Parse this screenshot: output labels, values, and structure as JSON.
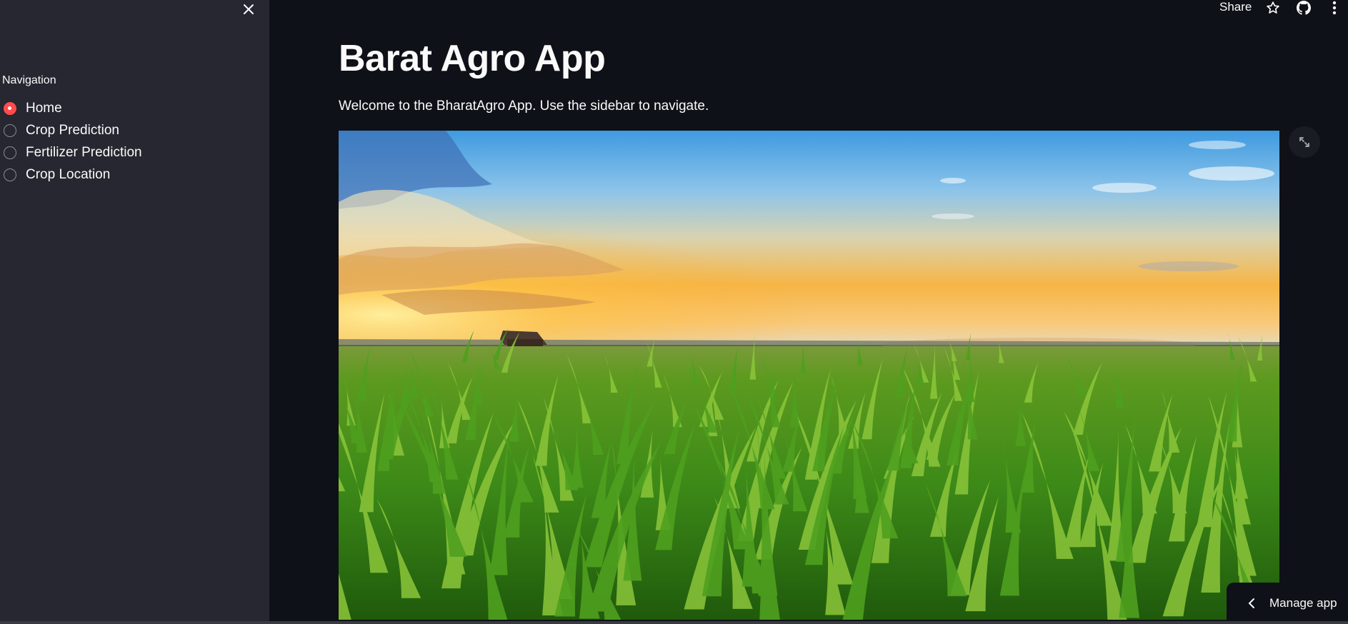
{
  "sidebar": {
    "nav_label": "Navigation",
    "items": [
      {
        "label": "Home",
        "selected": true
      },
      {
        "label": "Crop Prediction",
        "selected": false
      },
      {
        "label": "Fertilizer Prediction",
        "selected": false
      },
      {
        "label": "Crop Location",
        "selected": false
      }
    ]
  },
  "header": {
    "share_label": "Share",
    "icons": [
      "star-icon",
      "github-icon",
      "more-vertical-icon"
    ]
  },
  "main": {
    "title": "Barat Agro App",
    "welcome": "Welcome to the BharatAgro App. Use the sidebar to navigate.",
    "image_subject": "cornfield-sunset"
  },
  "footer": {
    "manage_app_label": "Manage app"
  },
  "colors": {
    "background": "#0e1117",
    "sidebar": "#262730",
    "accent": "#ff4b4b",
    "text": "#fafafa"
  }
}
